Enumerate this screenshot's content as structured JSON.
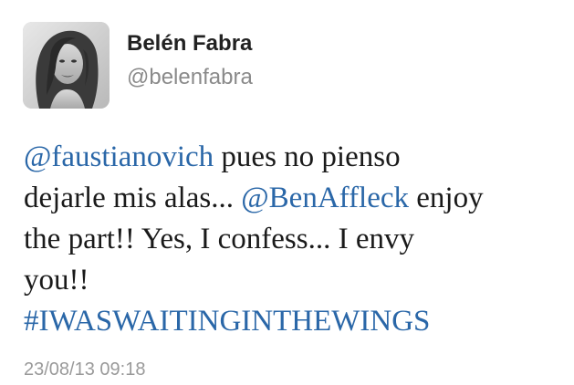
{
  "user": {
    "display_name": "Belén Fabra",
    "handle": "@belenfabra"
  },
  "tweet": {
    "mention_1": "@faustianovich",
    "text_1": " pues no pienso",
    "text_2": "dejarle mis alas... ",
    "mention_2": "@BenAffleck",
    "text_3": " enjoy",
    "text_4": "the part!! Yes, I confess... I envy",
    "text_5": "you!!",
    "hashtag": "#IWASWAITINGINTHEWINGS",
    "timestamp": "23/08/13 09:18"
  },
  "colors": {
    "link": "#2a67a8",
    "text": "#1a1a1a",
    "muted": "#8a8a8a"
  }
}
